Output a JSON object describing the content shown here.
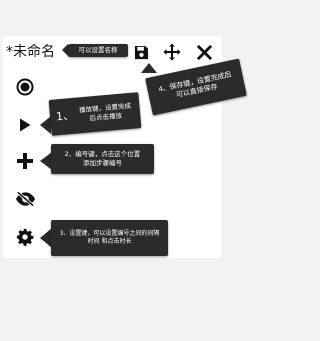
{
  "toolbar": {
    "title": "*未命名",
    "title_hint": "可以设置名称",
    "icons": [
      "save-icon",
      "move-icon",
      "close-icon"
    ]
  },
  "side_buttons": [
    "record-icon",
    "play-icon",
    "add-icon",
    "hide-icon",
    "settings-icon"
  ],
  "tips": {
    "play": {
      "num": "1、",
      "text": "播放键，设置完成后点击播放"
    },
    "add": {
      "text": "2、编号键，点击这个位置添加步骤编号"
    },
    "settings": {
      "text": "3、设置键，可以设置编号之间的间隔时间 和点击时长"
    },
    "save": {
      "text": "4、保存键，设置完成后可以直接保存"
    }
  },
  "colors": {
    "bubble": "#2b2b2b",
    "icon": "#111111"
  }
}
